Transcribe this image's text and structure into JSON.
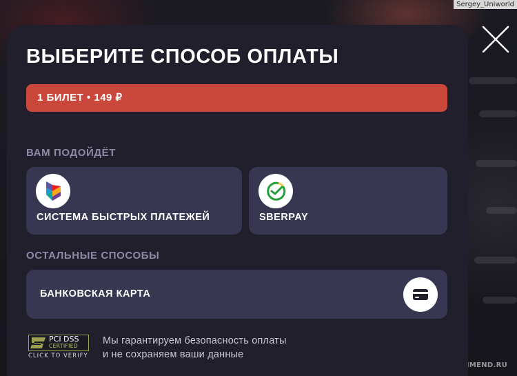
{
  "watermark": {
    "top": "Sergey_Uniworld",
    "bottom": "RECOMMEND.RU",
    "bottom_badge": "i"
  },
  "modal": {
    "title": "ВЫБЕРИТЕ СПОСОБ ОПЛАТЫ",
    "price_bar": "1 БИЛЕТ • 149 ₽",
    "recommended_label": "ВАМ ПОДОЙДЁТ",
    "recommended_methods": [
      {
        "name": "СИСТЕМА БЫСТРЫХ ПЛАТЕЖЕЙ",
        "icon": "sbp-logo-icon"
      },
      {
        "name": "SBERPAY",
        "icon": "sberpay-logo-icon"
      }
    ],
    "other_label": "ОСТАЛЬНЫЕ СПОСОБЫ",
    "other_methods": [
      {
        "name": "БАНКОВСКАЯ КАРТА",
        "icon": "bank-card-icon"
      }
    ],
    "pci": {
      "main": "PCI DSS",
      "certified": "CERTIFIED",
      "verify": "CLICK TO VERIFY"
    },
    "security_note": {
      "line1": "Мы гарантируем безопасность оплаты",
      "line2": "и не сохраняем ваши данные"
    }
  },
  "colors": {
    "accent": "#c9473b",
    "modal_bg": "#201f2b",
    "card_bg": "#383751",
    "muted_label": "#8c8aa6"
  }
}
